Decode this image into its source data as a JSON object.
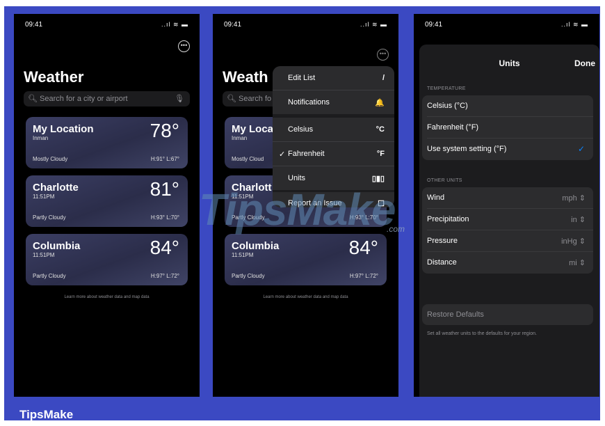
{
  "footer_label": "TipsMake",
  "watermark": {
    "text": "TipsMake",
    "suffix": ".com"
  },
  "status": {
    "time": "09:41",
    "icons": "..ıl ≋ ▬"
  },
  "screen1": {
    "title": "Weather",
    "search_placeholder": "Search for a city or airport",
    "more_icon": "ellipsis-circle-icon",
    "cards": [
      {
        "name": "My Location",
        "sub": "Inman",
        "temp": "78°",
        "condition": "Mostly Cloudy",
        "hilo": "H:91° L:67°"
      },
      {
        "name": "Charlotte",
        "sub": "11:51PM",
        "temp": "81°",
        "condition": "Partly Cloudy",
        "hilo": "H:93° L:70°"
      },
      {
        "name": "Columbia",
        "sub": "11:51PM",
        "temp": "84°",
        "condition": "Partly Cloudy",
        "hilo": "H:97° L:72°"
      }
    ],
    "learn_more": "Learn more about weather data and map data"
  },
  "screen2": {
    "title": "Weath",
    "search_placeholder": "Search fo",
    "cards": [
      {
        "name": "My Loca",
        "sub": "Inman",
        "temp": "78°",
        "condition": "Mostly Cloud",
        "hilo": ""
      },
      {
        "name": "Charlott",
        "sub": "11:51PM",
        "temp": "81°",
        "condition": "Partly Cloudy",
        "hilo": "H:93° L:70°"
      },
      {
        "name": "Columbia",
        "sub": "11:51PM",
        "temp": "84°",
        "condition": "Partly Cloudy",
        "hilo": "H:97° L:72°"
      }
    ],
    "learn_more": "Learn more about weather data and map data",
    "menu": {
      "edit_list": {
        "label": "Edit List",
        "icon": "/"
      },
      "notifications": {
        "label": "Notifications",
        "icon": "🔔"
      },
      "celsius": {
        "label": "Celsius",
        "icon": "°C"
      },
      "fahrenheit": {
        "label": "Fahrenheit",
        "icon": "°F",
        "check": "✓"
      },
      "units": {
        "label": "Units",
        "icon": "▯▮▯"
      },
      "report": {
        "label": "Report an Issue",
        "icon": "☐"
      }
    }
  },
  "screen3": {
    "title": "Units",
    "done_label": "Done",
    "temperature_header": "TEMPERATURE",
    "temperature_rows": [
      {
        "label": "Celsius (°C)",
        "value": ""
      },
      {
        "label": "Fahrenheit (°F)",
        "value": ""
      },
      {
        "label": "Use system setting (°F)",
        "value": "✓"
      }
    ],
    "other_header": "OTHER UNITS",
    "other_rows": [
      {
        "label": "Wind",
        "value": "mph ⇕"
      },
      {
        "label": "Precipitation",
        "value": "in ⇕"
      },
      {
        "label": "Pressure",
        "value": "inHg ⇕"
      },
      {
        "label": "Distance",
        "value": "mi ⇕"
      }
    ],
    "restore_label": "Restore Defaults",
    "restore_note": "Set all weather units to the defaults for your region."
  },
  "colors": {
    "frame": "#3b49c2",
    "accent_blue": "#0a84ff"
  }
}
